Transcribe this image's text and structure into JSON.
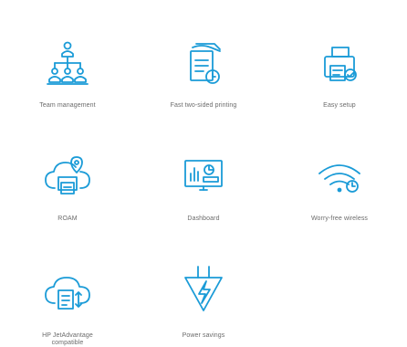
{
  "colors": {
    "icon_stroke": "#1a9bd7",
    "label": "#6b6b6b",
    "background": "#ffffff"
  },
  "features": [
    {
      "label": "Team management",
      "icon": "org-chart-icon"
    },
    {
      "label": "Fast two-sided printing",
      "icon": "duplex-printing-icon"
    },
    {
      "label": "Easy setup",
      "icon": "printer-check-icon"
    },
    {
      "label": "ROAM",
      "icon": "cloud-location-icon"
    },
    {
      "label": "Dashboard",
      "icon": "monitor-dashboard-icon"
    },
    {
      "label": "Worry-free wireless",
      "icon": "wireless-icon"
    },
    {
      "label": "HP JetAdvantage compatible",
      "icon": "cloud-document-icon"
    },
    {
      "label": "Power savings",
      "icon": "power-savings-icon"
    }
  ]
}
